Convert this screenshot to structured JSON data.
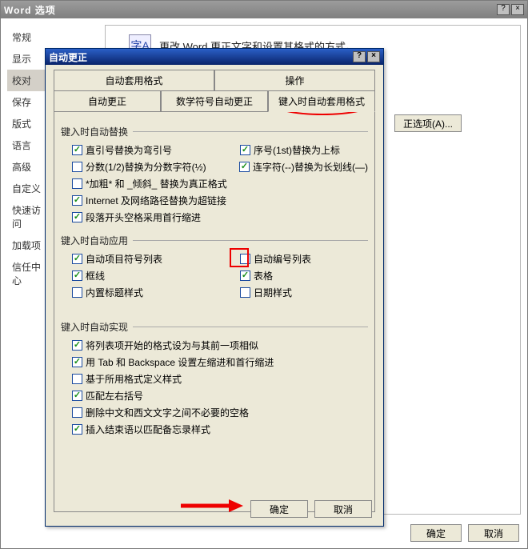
{
  "outer": {
    "title": "Word 选项",
    "heading": "更改 Word 更正文字和设置其格式的方式。",
    "sidebar": [
      "常规",
      "显示",
      "校对",
      "保存",
      "版式",
      "语言",
      "高级",
      "自定义",
      "快速访问",
      "加载项",
      "信任中心"
    ],
    "selected_sidebar_index": 2,
    "ok": "确定",
    "cancel": "取消",
    "autocorrect_options_btn": "正选项(A)..."
  },
  "inner": {
    "title": "自动更正",
    "tabs_top": [
      "自动套用格式",
      "操作"
    ],
    "tabs_bottom": [
      "自动更正",
      "数学符号自动更正",
      "键入时自动套用格式"
    ],
    "active_tab_index": 2,
    "groups": {
      "replace": {
        "label": "键入时自动替换",
        "left": [
          {
            "checked": true,
            "label": "直引号替换为弯引号"
          },
          {
            "checked": false,
            "label": "分数(1/2)替换为分数字符(½)"
          },
          {
            "checked": false,
            "label": "*加粗* 和 _倾斜_ 替换为真正格式"
          },
          {
            "checked": true,
            "label": "Internet 及网络路径替换为超链接"
          },
          {
            "checked": true,
            "label": "段落开头空格采用首行缩进"
          }
        ],
        "right": [
          {
            "checked": true,
            "label": "序号(1st)替换为上标"
          },
          {
            "checked": true,
            "label": "连字符(--)替换为长划线(—)"
          }
        ]
      },
      "apply": {
        "label": "键入时自动应用",
        "left": [
          {
            "checked": true,
            "label": "自动项目符号列表"
          },
          {
            "checked": true,
            "label": "框线"
          },
          {
            "checked": false,
            "label": "内置标题样式"
          }
        ],
        "right": [
          {
            "checked": false,
            "label": "自动编号列表"
          },
          {
            "checked": true,
            "label": "表格"
          },
          {
            "checked": false,
            "label": "日期样式"
          }
        ]
      },
      "auto": {
        "label": "键入时自动实现",
        "items": [
          {
            "checked": true,
            "label": "将列表项开始的格式设为与其前一项相似"
          },
          {
            "checked": true,
            "label": "用 Tab 和 Backspace 设置左缩进和首行缩进"
          },
          {
            "checked": false,
            "label": "基于所用格式定义样式"
          },
          {
            "checked": true,
            "label": "匹配左右括号"
          },
          {
            "checked": false,
            "label": "删除中文和西文文字之间不必要的空格"
          },
          {
            "checked": true,
            "label": "插入结束语以匹配备忘录样式"
          }
        ]
      }
    },
    "ok": "确定",
    "cancel": "取消"
  }
}
